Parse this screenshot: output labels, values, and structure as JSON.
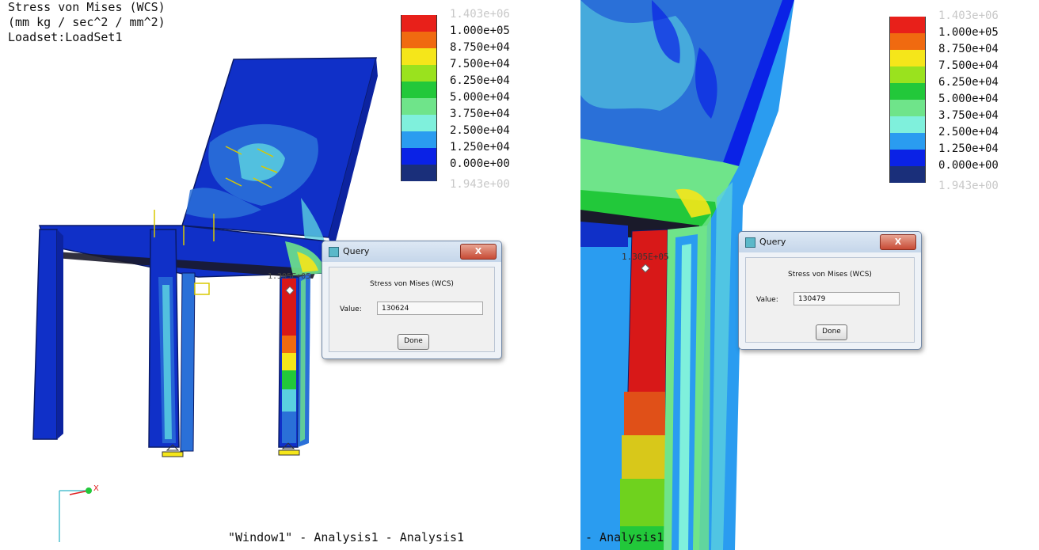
{
  "left_view": {
    "title": "Stress von Mises (WCS)",
    "units": "(mm kg / sec^2 / mm^2)",
    "loadset": "Loadset:LoadSet1",
    "footer": "\"Window1\" - Analysis1 - Analysis1",
    "probe_label": "1.305E+05",
    "triad_label": "X"
  },
  "right_view": {
    "footer": "- Analysis1",
    "probe_label": "1.305E+05"
  },
  "legend": {
    "max_label": "1.403e+06",
    "min_label": "1.943e+00",
    "levels": [
      {
        "label": "1.000e+05",
        "color": "#e8201a"
      },
      {
        "label": "8.750e+04",
        "color": "#f06a10"
      },
      {
        "label": "7.500e+04",
        "color": "#f5e61a"
      },
      {
        "label": "6.250e+04",
        "color": "#9ae21e"
      },
      {
        "label": "5.000e+04",
        "color": "#22c83a"
      },
      {
        "label": "3.750e+04",
        "color": "#6fe48a"
      },
      {
        "label": "2.500e+04",
        "color": "#7ff0dc"
      },
      {
        "label": "1.250e+04",
        "color": "#2a9cf0"
      },
      {
        "label": "0.000e+00",
        "color": "#0a22e6"
      },
      {
        "label": "",
        "color": "#1a2f7a"
      }
    ]
  },
  "dialog_left": {
    "title": "Query",
    "close_label": "X",
    "heading": "Stress von Mises (WCS)",
    "value_label": "Value:",
    "value": "130624",
    "done_label": "Done"
  },
  "dialog_right": {
    "title": "Query",
    "close_label": "X",
    "heading": "Stress von Mises (WCS)",
    "value_label": "Value:",
    "value": "130479",
    "done_label": "Done"
  },
  "colors": {
    "model_blue": "#1030c8",
    "edge": "#0a1a66",
    "mid_blue": "#2a70d8",
    "cyan": "#5ad0e0",
    "red": "#d81818"
  }
}
